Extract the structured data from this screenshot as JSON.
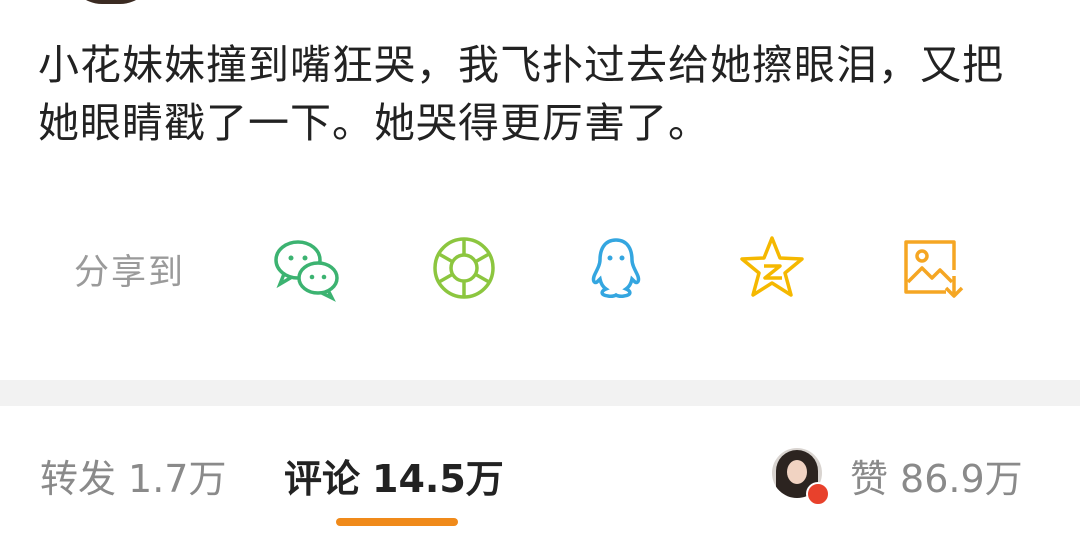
{
  "post": {
    "line1": "小花妹妹撞到嘴狂哭，我飞扑过去给她擦眼泪，又把",
    "line2": "她眼睛戳了一下。她哭得更厉害了。"
  },
  "share": {
    "label": "分享到",
    "targets": [
      {
        "icon": "wechat-icon",
        "color": "#3cb371"
      },
      {
        "icon": "moments-icon",
        "color": "#8cc63f"
      },
      {
        "icon": "qq-icon",
        "color": "#34a6e0"
      },
      {
        "icon": "qzone-icon",
        "color": "#f5b800"
      },
      {
        "icon": "save-image-icon",
        "color": "#f5a623"
      }
    ]
  },
  "tabs": {
    "repost": {
      "label": "转发",
      "count": "1.7万"
    },
    "comment": {
      "label": "评论",
      "count": "14.5万"
    },
    "like": {
      "label": "赞",
      "count": "86.9万"
    }
  },
  "colors": {
    "accent": "#f08a1a",
    "text": "#222222",
    "muted": "#8a8a8a",
    "divider": "#f2f2f2"
  }
}
